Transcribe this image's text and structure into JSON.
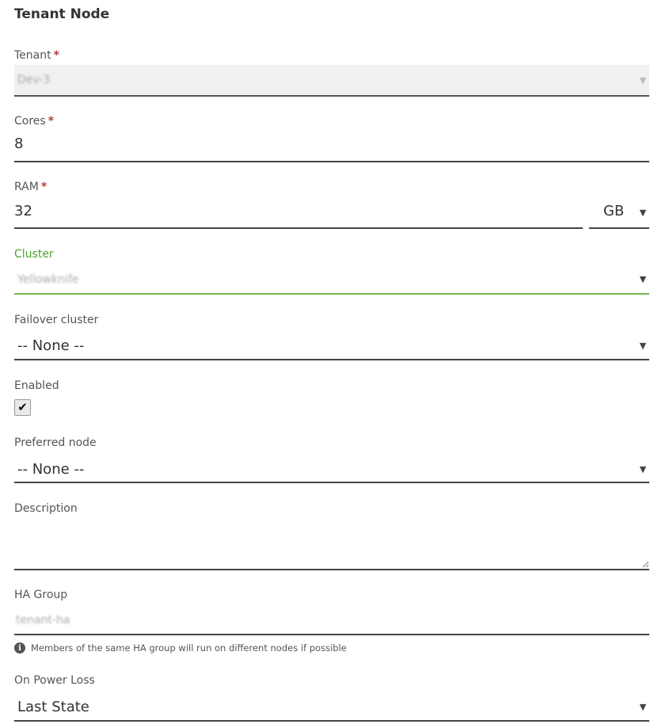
{
  "section_title": "Tenant Node",
  "fields": {
    "tenant": {
      "label": "Tenant",
      "required_mark": "*",
      "value": "Dev-3"
    },
    "cores": {
      "label": "Cores",
      "required_mark": "*",
      "value": "8"
    },
    "ram": {
      "label": "RAM",
      "required_mark": "*",
      "value": "32",
      "unit": "GB"
    },
    "cluster": {
      "label": "Cluster",
      "value": "Yellowknife"
    },
    "failover_cluster": {
      "label": "Failover cluster",
      "value": "-- None --"
    },
    "enabled": {
      "label": "Enabled",
      "checked": true,
      "check_glyph": "✔"
    },
    "preferred_node": {
      "label": "Preferred node",
      "value": "-- None --"
    },
    "description": {
      "label": "Description",
      "value": ""
    },
    "ha_group": {
      "label": "HA Group",
      "value": "tenant-ha",
      "help": "Members of the same HA group will run on different nodes if possible"
    },
    "on_power_loss": {
      "label": "On Power Loss",
      "value": "Last State"
    }
  },
  "dropdown_arrow": "▼",
  "info_glyph": "i",
  "colors": {
    "required": "#b23b3b",
    "focus": "#72b84a",
    "focus_label": "#4aa32e",
    "underline": "#444444"
  },
  "icons": [
    "dropdown-arrow-icon",
    "checkmark-icon",
    "info-icon",
    "resize-handle-icon"
  ]
}
